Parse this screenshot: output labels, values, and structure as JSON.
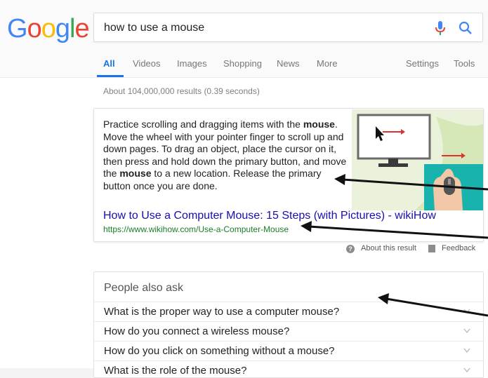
{
  "logo": {
    "letters": [
      "G",
      "o",
      "o",
      "g",
      "l",
      "e"
    ],
    "colors": [
      "#4285F4",
      "#EA4335",
      "#FBBC05",
      "#4285F4",
      "#34A853",
      "#EA4335"
    ]
  },
  "search": {
    "query": "how to use a mouse",
    "mic_icon": "microphone-icon",
    "search_icon": "magnifier-icon"
  },
  "tabs": [
    {
      "label": "All",
      "active": true
    },
    {
      "label": "Videos"
    },
    {
      "label": "Images"
    },
    {
      "label": "Shopping"
    },
    {
      "label": "News"
    },
    {
      "label": "More"
    },
    {
      "label": "Settings"
    },
    {
      "label": "Tools"
    }
  ],
  "result_stats": "About 104,000,000 results (0.39 seconds)",
  "featured_snippet": {
    "text_1": "Practice scrolling and dragging items with the ",
    "bold_1": "mouse",
    "text_2": ". Move the wheel with your pointer finger to scroll up and down pages. To drag an object, place the cursor on it, then press and hold down the primary button, and move the ",
    "bold_2": "mouse",
    "text_3": " to a new location. Release the primary button once you are done.",
    "title": "How to Use a Computer Mouse: 15 Steps (with Pictures) - wikiHow",
    "url": "https://www.wikihow.com/Use-a-Computer-Mouse",
    "about_label": "About this result",
    "feedback_label": "Feedback"
  },
  "people_also_ask": {
    "title": "People also ask",
    "questions": [
      "What is the proper way to use a computer mouse?",
      "How do you connect a wireless mouse?",
      "How do you click on something without a mouse?",
      "What is the role of the mouse?"
    ]
  },
  "colors": {
    "accent": "#1a73e8",
    "link": "#1a0dab",
    "url": "#1a7d2a"
  }
}
